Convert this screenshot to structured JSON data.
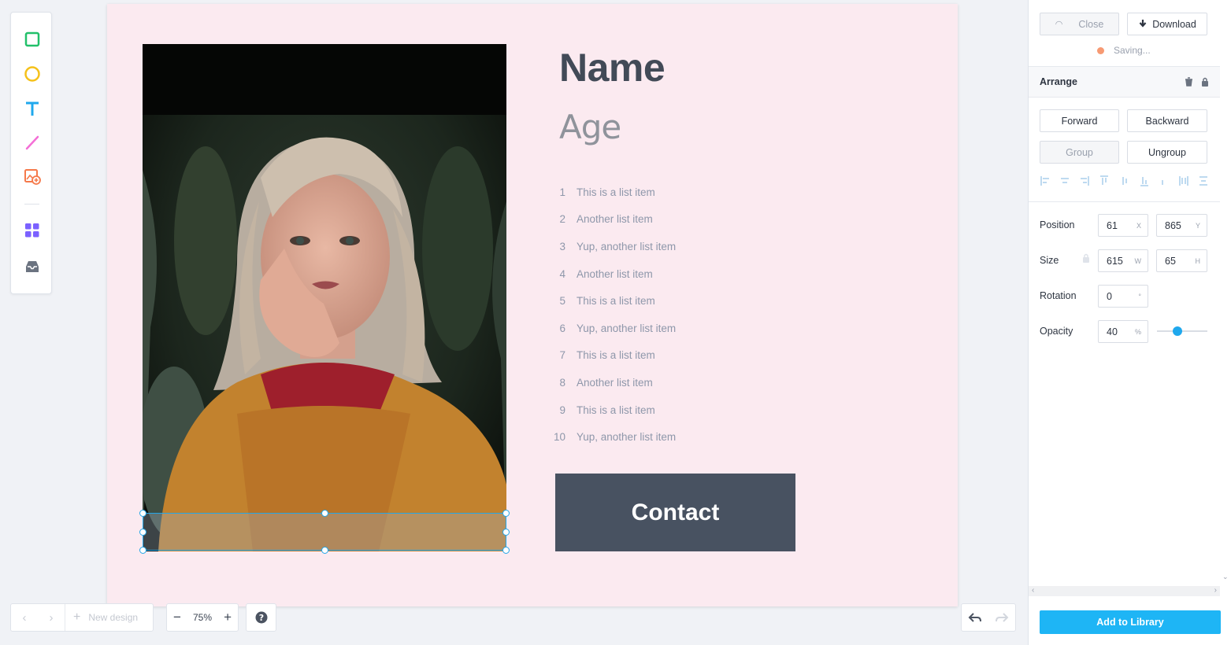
{
  "toolbar": {
    "tools": [
      {
        "icon": "rectangle-icon",
        "color": "#22c06a"
      },
      {
        "icon": "circle-icon",
        "color": "#f5c11a"
      },
      {
        "icon": "text-icon",
        "color": "#1fa8ed"
      },
      {
        "icon": "line-icon",
        "color": "#f46fd6"
      },
      {
        "icon": "image-upload-icon",
        "color": "#f5794a"
      },
      {
        "icon": "grid-icon",
        "color": "#7b61ff"
      },
      {
        "icon": "inbox-icon",
        "color": "#6b7380"
      }
    ]
  },
  "canvas": {
    "background": "#fbeaf0",
    "name": "Name",
    "age": "Age",
    "list": [
      {
        "num": "1",
        "text": "This is a list item"
      },
      {
        "num": "2",
        "text": "Another list item"
      },
      {
        "num": "3",
        "text": "Yup, another list item"
      },
      {
        "num": "4",
        "text": "Another list item"
      },
      {
        "num": "5",
        "text": "This is a list item"
      },
      {
        "num": "6",
        "text": "Yup, another list item"
      },
      {
        "num": "7",
        "text": "This is a list item"
      },
      {
        "num": "8",
        "text": "Another list item"
      },
      {
        "num": "9",
        "text": "This is a list item"
      },
      {
        "num": "10",
        "text": "Yup, another list item"
      }
    ],
    "contact_label": "Contact"
  },
  "bottom": {
    "new_design": "New design",
    "zoom": "75%"
  },
  "panel": {
    "close": "Close",
    "download": "Download",
    "saving": "Saving...",
    "arrange": "Arrange",
    "forward": "Forward",
    "backward": "Backward",
    "group": "Group",
    "ungroup": "Ungroup",
    "position_label": "Position",
    "position_x": "61",
    "position_x_unit": "X",
    "position_y": "865",
    "position_y_unit": "Y",
    "size_label": "Size",
    "size_w": "615",
    "size_w_unit": "W",
    "size_h": "65",
    "size_h_unit": "H",
    "rotation_label": "Rotation",
    "rotation": "0",
    "rotation_unit": "°",
    "opacity_label": "Opacity",
    "opacity": "40",
    "opacity_unit": "%",
    "opacity_slider_fraction": 0.4,
    "add_to_library": "Add to Library",
    "accent": "#1eb5f5"
  }
}
